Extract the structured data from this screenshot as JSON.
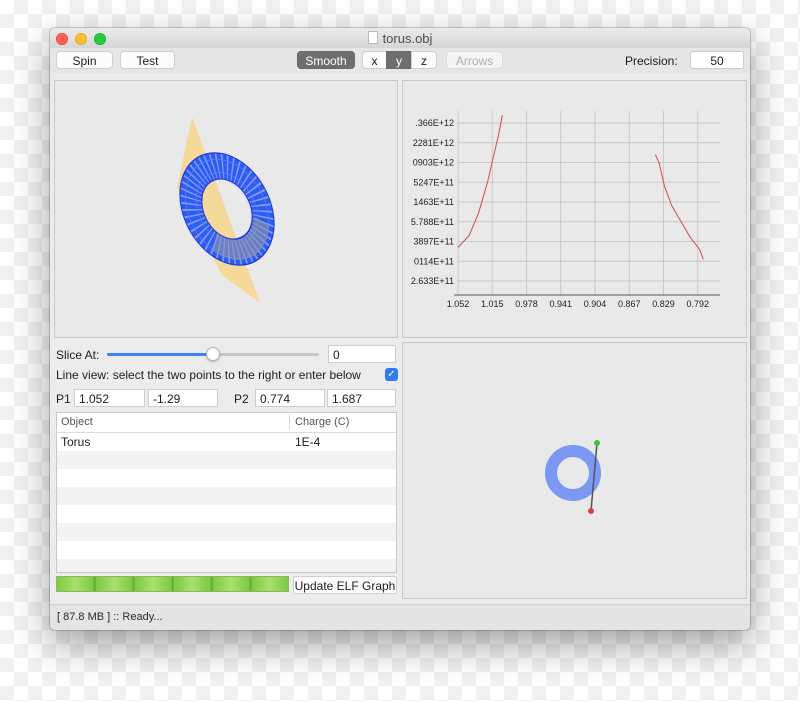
{
  "window": {
    "title": "torus.obj"
  },
  "toolbar": {
    "spin_label": "Spin",
    "test_label": "Test",
    "smooth_label": "Smooth",
    "axis_x": "x",
    "axis_y": "y",
    "axis_z": "z",
    "selected_axis": "y",
    "arrows_label": "Arrows",
    "precision_label": "Precision:",
    "precision_value": "50"
  },
  "slice": {
    "label": "Slice At:",
    "value": "0",
    "slider_fraction": 0.5
  },
  "line_view": {
    "label": "Line view: select the two points to the right or enter below",
    "checked": true,
    "p1_label": "P1",
    "p1_x": "1.052",
    "p1_y": "-1.29",
    "p2_label": "P2",
    "p2_x": "0.774",
    "p2_y": "1.687"
  },
  "objects_table": {
    "columns": [
      "Object",
      "Charge (C)"
    ],
    "rows": [
      {
        "object": "Torus",
        "charge": "1E-4"
      }
    ]
  },
  "progress": {
    "fraction": 1.0
  },
  "update_button": "Update ELF Graph",
  "status": "[ 87.8 MB ] :: Ready...",
  "colors": {
    "slider_accent": "#3b82f6",
    "graph_line": "#d64a4a",
    "torus_blue": "#2f5bf5",
    "slice_plane": "#f7d68a"
  },
  "chart_data": {
    "type": "line",
    "title": "",
    "xlabel": "",
    "ylabel": "",
    "x_tick_labels": [
      "1.052",
      "1.015",
      "0.978",
      "0.941",
      "0.904",
      "0.867",
      "0.829",
      "0.792"
    ],
    "y_tick_labels": [
      ".366E+12",
      "2281E+12",
      "0903E+12",
      "5247E+11",
      "1463E+11",
      "5.788E+11",
      "3897E+11",
      "0114E+11",
      "2.633E+11"
    ],
    "grid": true,
    "series": [
      {
        "segments": [
          [
            [
              1.052,
              2.7
            ],
            [
              1.04,
              3.3
            ],
            [
              1.03,
              4.4
            ],
            [
              1.02,
              6.0
            ],
            [
              1.015,
              7.0
            ],
            [
              1.008,
              8.4
            ],
            [
              1.004,
              9.4
            ]
          ],
          [
            [
              0.838,
              7.4
            ],
            [
              0.834,
              7.0
            ],
            [
              0.828,
              5.8
            ],
            [
              0.82,
              4.8
            ],
            [
              0.81,
              4.0
            ],
            [
              0.8,
              3.2
            ],
            [
              0.79,
              2.6
            ],
            [
              0.786,
              2.1
            ]
          ]
        ]
      }
    ]
  }
}
